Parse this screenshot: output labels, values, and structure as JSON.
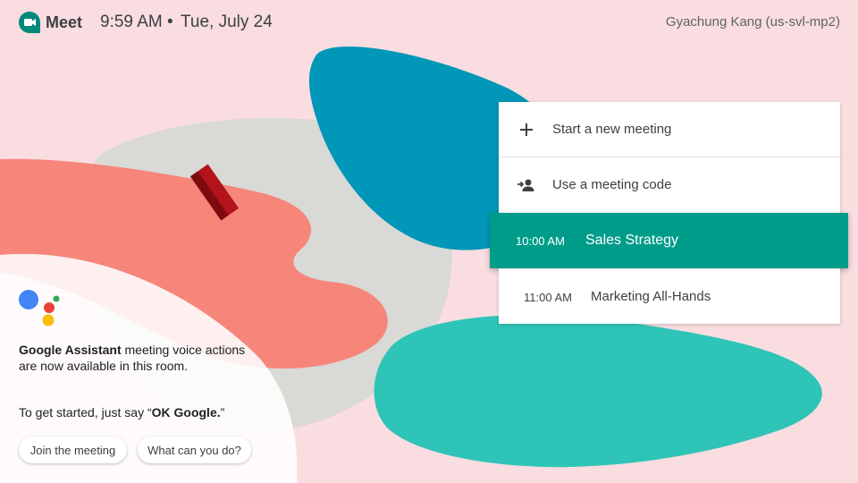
{
  "header": {
    "app_name": "Meet",
    "time": "9:59 AM",
    "separator": "•",
    "date": "Tue, July 24",
    "room_name": "Gyachung Kang (us-svl-mp2)"
  },
  "menu": {
    "new_meeting": "Start a new meeting",
    "meeting_code": "Use a meeting code",
    "meetings": [
      {
        "time": "10:00 AM",
        "title": "Sales Strategy",
        "selected": true
      },
      {
        "time": "11:00 AM",
        "title": "Marketing All-Hands",
        "selected": false
      }
    ]
  },
  "assistant": {
    "line_bold": "Google Assistant",
    "line_rest": " meeting voice actions are now available in this room.",
    "prompt_prefix": "To get started, just say “",
    "prompt_bold": "OK Google.",
    "prompt_suffix": "”",
    "chips": [
      "Join the meeting",
      "What can you do?"
    ]
  },
  "colors": {
    "background": "#f9dde0",
    "accent_teal": "#009c8a",
    "blob_blue": "#0097b8",
    "blob_teal": "#2fc4b8",
    "blob_coral": "#f6857a",
    "blob_grey": "#d9d9d6"
  },
  "icons": {
    "logo": "meet-logo-icon",
    "new_meeting": "plus-icon",
    "meeting_code": "person-add-icon",
    "assistant": "google-assistant-icon"
  }
}
